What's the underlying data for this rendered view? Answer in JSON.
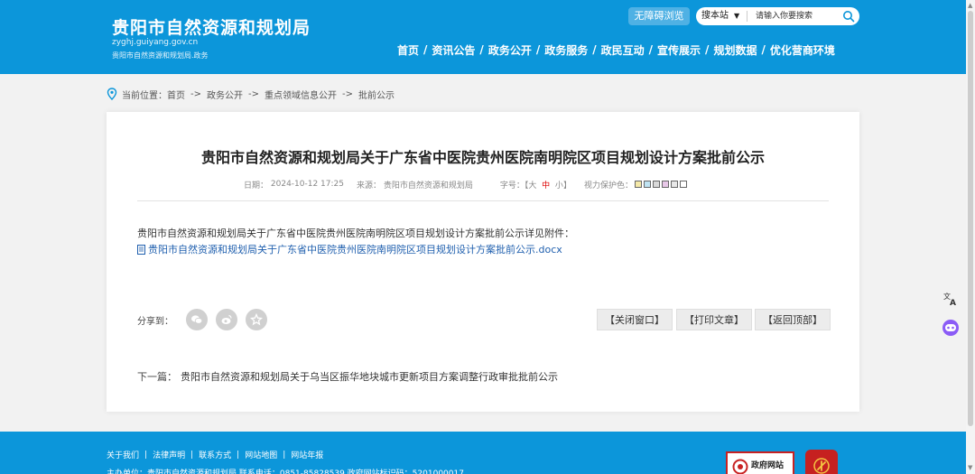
{
  "header": {
    "title": "贵阳市自然资源和规划局",
    "domain": "zyghj.guiyang.gov.cn",
    "subtitle": "贵阳市自然资源和规划局.政务",
    "accessibility_label": "无障碍浏览",
    "search": {
      "scope_selected": "搜本站",
      "placeholder": "请输入你要搜索"
    },
    "nav": [
      "首页",
      "资讯公告",
      "政务公开",
      "政务服务",
      "政民互动",
      "宣传展示",
      "规划数据",
      "优化营商环境"
    ]
  },
  "breadcrumb": {
    "prefix": "当前位置：",
    "items": [
      "首页",
      "政务公开",
      "重点领域信息公开",
      "批前公示"
    ]
  },
  "article": {
    "title": "贵阳市自然资源和规划局关于广东省中医院贵州医院南明院区项目规划设计方案批前公示",
    "date_label": "日期：",
    "date": "2024-10-12 17:25",
    "source_label": "来源：",
    "source": "贵阳市自然资源和规划局",
    "font_label": "字号：【",
    "font_large": "大",
    "font_medium": "中",
    "font_small": "小",
    "font_close": "】",
    "eye_label": "视力保护色：",
    "eye_colors": [
      "#f5e9a8",
      "#bfe3f2",
      "#d9d9d9",
      "#e8c8e8",
      "#e8e8e8",
      "#ffffff"
    ],
    "body": "贵阳市自然资源和规划局关于广东省中医院贵州医院南明院区项目规划设计方案批前公示详见附件：",
    "attachment": "贵阳市自然资源和规划局关于广东省中医院贵州医院南明院区项目规划设计方案批前公示.docx",
    "share_label": "分享到：",
    "buttons": {
      "close": "【关闭窗口】",
      "print": "【打印文章】",
      "top": "【返回顶部】"
    },
    "next_label": "下一篇：",
    "next_title": "贵阳市自然资源和规划局关于乌当区振华地块城市更新项目方案调整行政审批批前公示"
  },
  "footer": {
    "links": [
      "关于我们",
      "法律声明",
      "联系方式",
      "网站地图",
      "网站年报"
    ],
    "info": "主办单位：贵阳市自然资源和规划局  联系电话：0851-85828539  政府网站标识码：5201000017",
    "badge": "政府网站"
  },
  "colors": {
    "brand_blue": "#0c96da",
    "link_blue": "#1f5fae",
    "badge_red": "#c82222"
  }
}
